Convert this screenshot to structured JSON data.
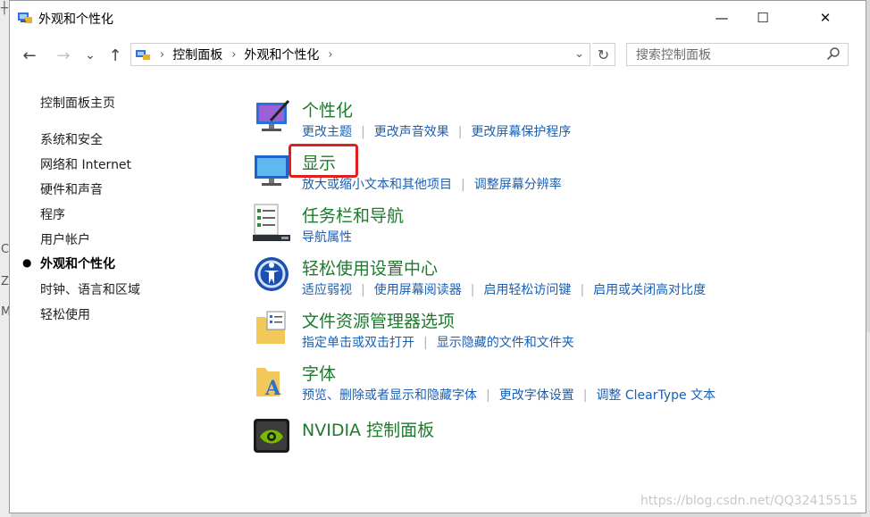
{
  "window": {
    "title": "外观和个性化"
  },
  "titlebar": {
    "minimize": "—",
    "maximize": "☐",
    "close": "✕"
  },
  "nav": {
    "back": "←",
    "forward": "→",
    "recent": "⌄",
    "up": "↑",
    "breadcrumb": [
      "控制面板",
      "外观和个性化"
    ],
    "search_placeholder": "搜索控制面板"
  },
  "sidebar": {
    "home": "控制面板主页",
    "items": [
      {
        "label": "系统和安全"
      },
      {
        "label": "网络和 Internet"
      },
      {
        "label": "硬件和声音"
      },
      {
        "label": "程序"
      },
      {
        "label": "用户帐户"
      },
      {
        "label": "外观和个性化",
        "active": true
      },
      {
        "label": "时钟、语言和区域"
      },
      {
        "label": "轻松使用"
      }
    ]
  },
  "categories": [
    {
      "title": "个性化",
      "icon": "personalization-icon",
      "links": [
        "更改主题",
        "更改声音效果",
        "更改屏幕保护程序"
      ]
    },
    {
      "title": "显示",
      "icon": "display-icon",
      "links": [
        "放大或缩小文本和其他项目",
        "调整屏幕分辨率"
      ]
    },
    {
      "title": "任务栏和导航",
      "icon": "taskbar-icon",
      "links": [
        "导航属性"
      ]
    },
    {
      "title": "轻松使用设置中心",
      "icon": "ease-of-access-icon",
      "links": [
        "适应弱视",
        "使用屏幕阅读器",
        "启用轻松访问键",
        "启用或关闭高对比度"
      ]
    },
    {
      "title": "文件资源管理器选项",
      "icon": "folder-options-icon",
      "links": [
        "指定单击或双击打开",
        "显示隐藏的文件和文件夹"
      ]
    },
    {
      "title": "字体",
      "icon": "fonts-icon",
      "links": [
        "预览、删除或者显示和隐藏字体",
        "更改字体设置",
        "调整 ClearType 文本"
      ]
    },
    {
      "title": "NVIDIA 控制面板",
      "icon": "nvidia-icon",
      "links": []
    }
  ],
  "watermark": "https://blog.csdn.net/QQ32415515",
  "colors": {
    "link": "#1a5fb4",
    "heading": "#1e7a2d",
    "highlight": "#e0201c"
  },
  "background_window": {
    "chars": [
      "┼",
      "C",
      "Z",
      "M"
    ]
  }
}
